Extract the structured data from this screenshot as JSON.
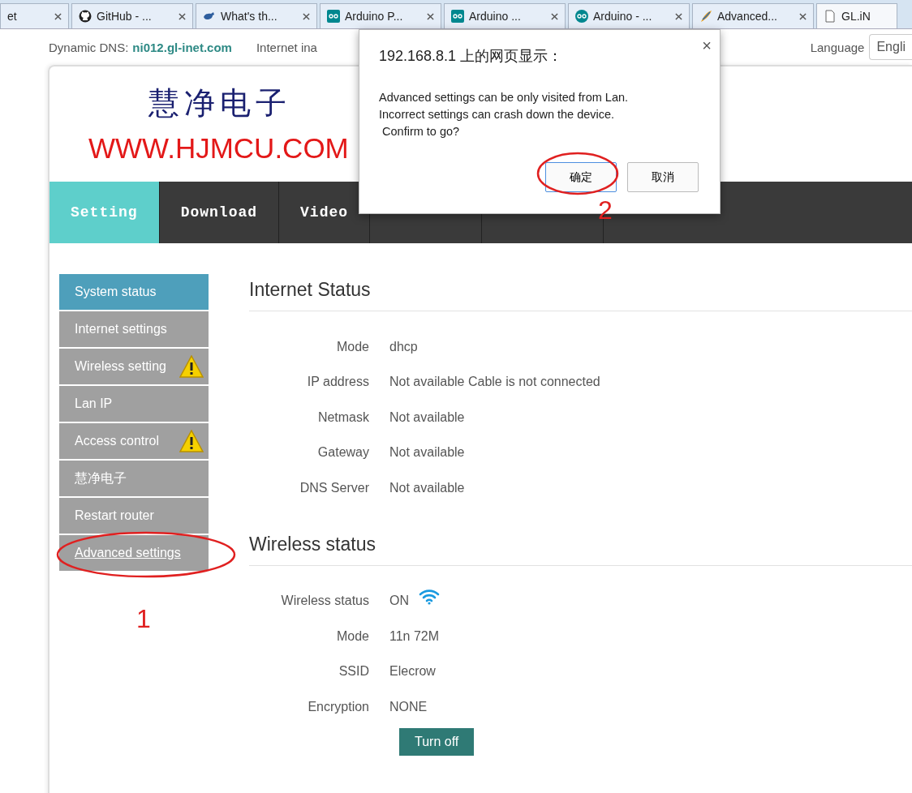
{
  "browser_tabs": [
    {
      "title": "et",
      "selected": false
    },
    {
      "title": "GitHub - ...",
      "selected": false
    },
    {
      "title": "What's th...",
      "selected": false
    },
    {
      "title": "Arduino P...",
      "selected": false
    },
    {
      "title": "Arduino ...",
      "selected": false
    },
    {
      "title": "Arduino - ...",
      "selected": false
    },
    {
      "title": "Advanced...",
      "selected": false
    },
    {
      "title": "GL.iN",
      "selected": true
    }
  ],
  "top_bar": {
    "dns_label": "Dynamic DNS:",
    "dns_value": "ni012.gl-inet.com",
    "internet_text": "Internet ina",
    "language_label": "Language",
    "language_value": "Engli"
  },
  "logo": {
    "title": "慧净电子",
    "url": "WWW.HJMCU.COM"
  },
  "nav": [
    {
      "label": "Setting",
      "selected": true
    },
    {
      "label": "Download",
      "selected": false
    },
    {
      "label": "Video",
      "selected": false
    },
    {
      "selected": false
    },
    {
      "selected": false
    }
  ],
  "sidebar": [
    {
      "label": "System status",
      "selected": true,
      "warning": false,
      "link": false
    },
    {
      "label": "Internet settings",
      "selected": false,
      "warning": false,
      "link": false
    },
    {
      "label": "Wireless setting",
      "selected": false,
      "warning": true,
      "link": false
    },
    {
      "label": "Lan IP",
      "selected": false,
      "warning": false,
      "link": false
    },
    {
      "label": "Access control",
      "selected": false,
      "warning": true,
      "link": false
    },
    {
      "label": "慧净电子",
      "selected": false,
      "warning": false,
      "link": false
    },
    {
      "label": "Restart router",
      "selected": false,
      "warning": false,
      "link": false
    },
    {
      "label": "Advanced settings",
      "selected": false,
      "warning": false,
      "link": true
    }
  ],
  "internet_status": {
    "title": "Internet Status",
    "rows": [
      {
        "label": "Mode",
        "value": "dhcp"
      },
      {
        "label": "IP address",
        "value": "Not available Cable is not connected"
      },
      {
        "label": "Netmask",
        "value": "Not available"
      },
      {
        "label": "Gateway",
        "value": "Not available"
      },
      {
        "label": "DNS Server",
        "value": "Not available"
      }
    ]
  },
  "wireless_status": {
    "title": "Wireless status",
    "rows": [
      {
        "label": "Wireless status",
        "value": "ON",
        "kind": "wifi"
      },
      {
        "label": "Mode",
        "value": "11n 72M",
        "kind": "text"
      },
      {
        "label": "SSID",
        "value": "Elecrow",
        "kind": "text"
      },
      {
        "label": "Encryption",
        "value": "NONE",
        "kind": "text"
      }
    ],
    "button": "Turn off"
  },
  "dialog": {
    "title": "192.168.8.1 上的网页显示：",
    "close": "×",
    "lines": [
      "Advanced settings can be only visited from Lan.",
      "Incorrect settings can crash down the device.",
      " Confirm to go?"
    ],
    "ok": "确定",
    "cancel": "取消"
  },
  "annotations": [
    {
      "label": "1"
    },
    {
      "label": "2"
    }
  ]
}
